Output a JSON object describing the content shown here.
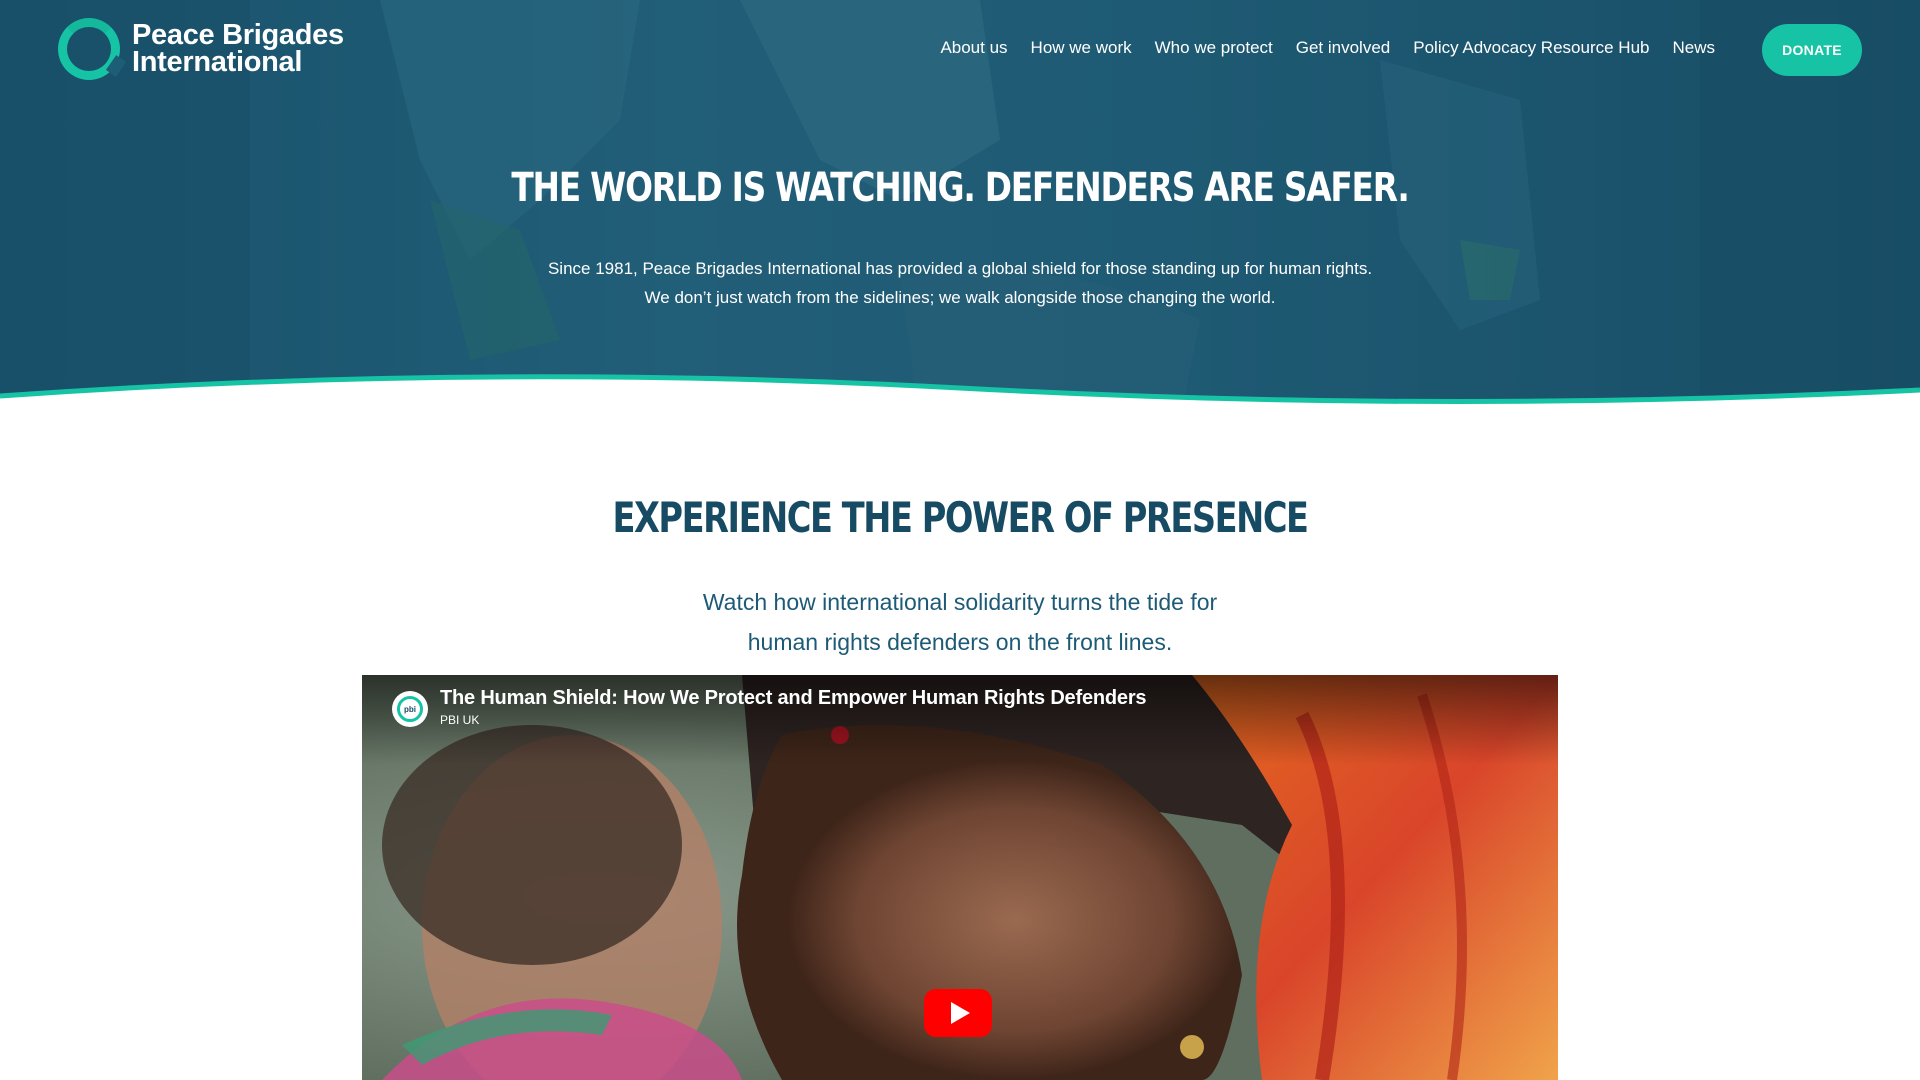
{
  "brand": {
    "name_line1": "Peace Brigades",
    "name_line2": "International",
    "accent_color": "#17c3a5",
    "primary_color": "#164b63"
  },
  "nav": {
    "items": [
      {
        "label": "About us"
      },
      {
        "label": "How we work"
      },
      {
        "label": "Who we protect"
      },
      {
        "label": "Get involved"
      },
      {
        "label": "Policy Advocacy Resource Hub"
      },
      {
        "label": "News"
      }
    ],
    "donate_label": "DONATE"
  },
  "hero": {
    "title": "THE WORLD IS WATCHING. DEFENDERS ARE SAFER.",
    "subtitle_line1": "Since 1981, Peace Brigades International has provided a global shield for those standing up for human rights.",
    "subtitle_line2": "We don’t just watch from the sidelines; we walk alongside those changing the world."
  },
  "section": {
    "title": "EXPERIENCE THE POWER OF PRESENCE",
    "subtitle_line1": "Watch how international solidarity turns the tide for",
    "subtitle_line2": "human rights defenders on the front lines."
  },
  "video": {
    "title": "The Human Shield: How We Protect and Empower Human Rights Defenders",
    "channel": "PBI UK",
    "avatar_text": "pbi",
    "play_icon": "play-icon",
    "play_color": "#ff0000"
  }
}
